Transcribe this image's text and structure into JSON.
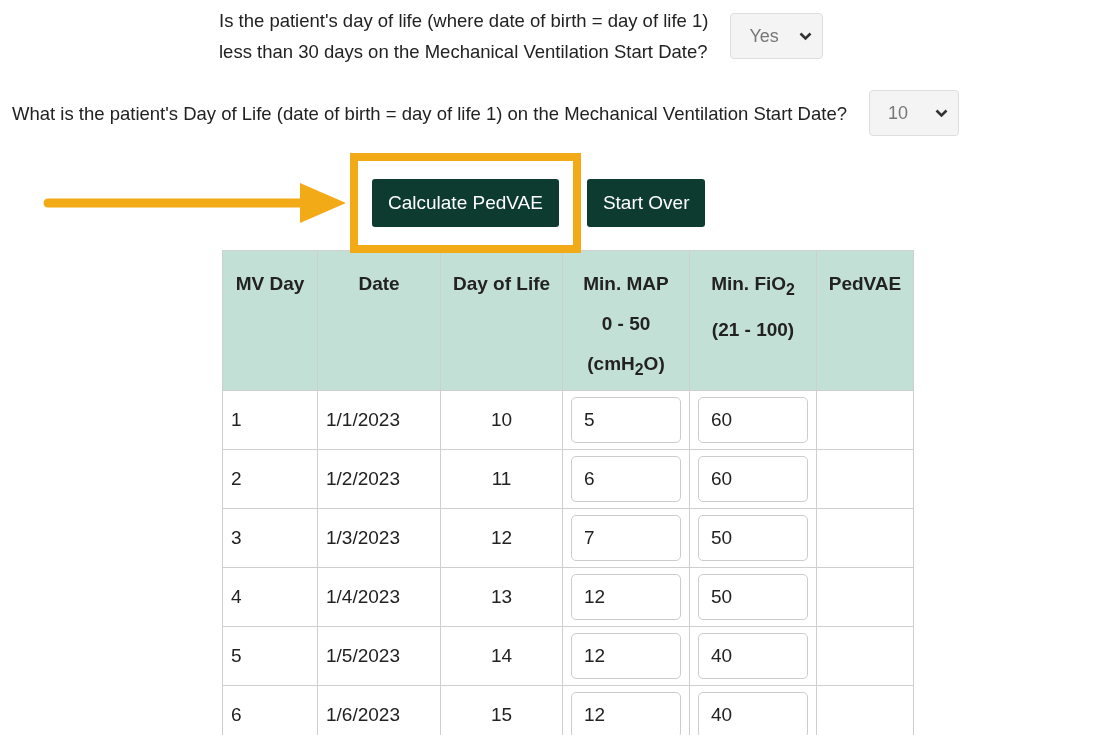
{
  "questions": [
    {
      "lines": [
        "Is the patient's day of life (where date of birth = day of life 1)",
        "less than 30 days on the Mechanical Ventilation Start Date?"
      ],
      "answer": "Yes"
    },
    {
      "lines": [
        "What is the patient's Day of Life (date of birth = day of life 1) on the Mechanical Ventilation Start Date?"
      ],
      "answer": "10"
    }
  ],
  "buttons": [
    {
      "label": "Calculate PedVAE",
      "highlighted": true
    },
    {
      "label": "Start Over",
      "highlighted": false
    }
  ],
  "table": {
    "columns": [
      [
        "MV Day"
      ],
      [
        "Date"
      ],
      [
        "Day of Life"
      ],
      [
        "Min. MAP",
        "0 - 50",
        "(cmH$_{2}$O)"
      ],
      [
        "Min. FiO$_{2}$",
        "(21 - 100)"
      ],
      [
        "PedVAE"
      ]
    ],
    "rows": [
      {
        "mv_day": "1",
        "date": "1/1/2023",
        "day_of_life": "10",
        "min_map": "5",
        "min_fio2": "60"
      },
      {
        "mv_day": "2",
        "date": "1/2/2023",
        "day_of_life": "11",
        "min_map": "6",
        "min_fio2": "60"
      },
      {
        "mv_day": "3",
        "date": "1/3/2023",
        "day_of_life": "12",
        "min_map": "7",
        "min_fio2": "50"
      },
      {
        "mv_day": "4",
        "date": "1/4/2023",
        "day_of_life": "13",
        "min_map": "12",
        "min_fio2": "50"
      },
      {
        "mv_day": "5",
        "date": "1/5/2023",
        "day_of_life": "14",
        "min_map": "12",
        "min_fio2": "40"
      },
      {
        "mv_day": "6",
        "date": "1/6/2023",
        "day_of_life": "15",
        "min_map": "12",
        "min_fio2": "40"
      }
    ]
  }
}
